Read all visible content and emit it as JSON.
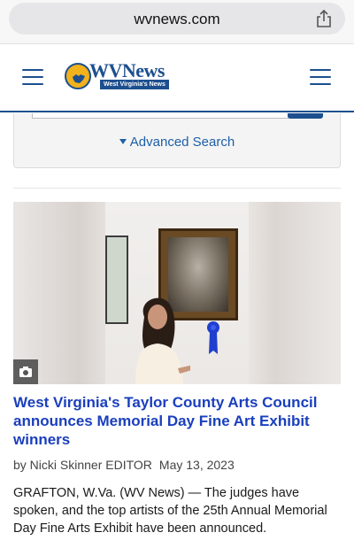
{
  "browser": {
    "url": "wvnews.com"
  },
  "header": {
    "logo_wordmark": "WVNews",
    "logo_tagline": "West Virginia's News"
  },
  "search": {
    "advanced_label": "Advanced Search"
  },
  "article": {
    "headline": "West Virginia's Taylor County Arts Council announces Memorial Day Fine Art Exhibit winners",
    "author": "by Nicki Skinner EDITOR",
    "date": "May 13, 2023",
    "summary": "GRAFTON, W.Va. (WV News) — The judges have spoken, and the top artists of the 25th Annual Memorial Day Fine Arts Exhibit have been announced."
  },
  "icons": [
    "share-icon",
    "menu-icon",
    "wv-state-icon",
    "caret-down-icon",
    "camera-icon"
  ],
  "colors": {
    "brand_blue": "#1d4f8f",
    "brand_gold": "#f2b21b",
    "headline_blue": "#1a3fbd",
    "link_blue": "#1d5fa8"
  }
}
